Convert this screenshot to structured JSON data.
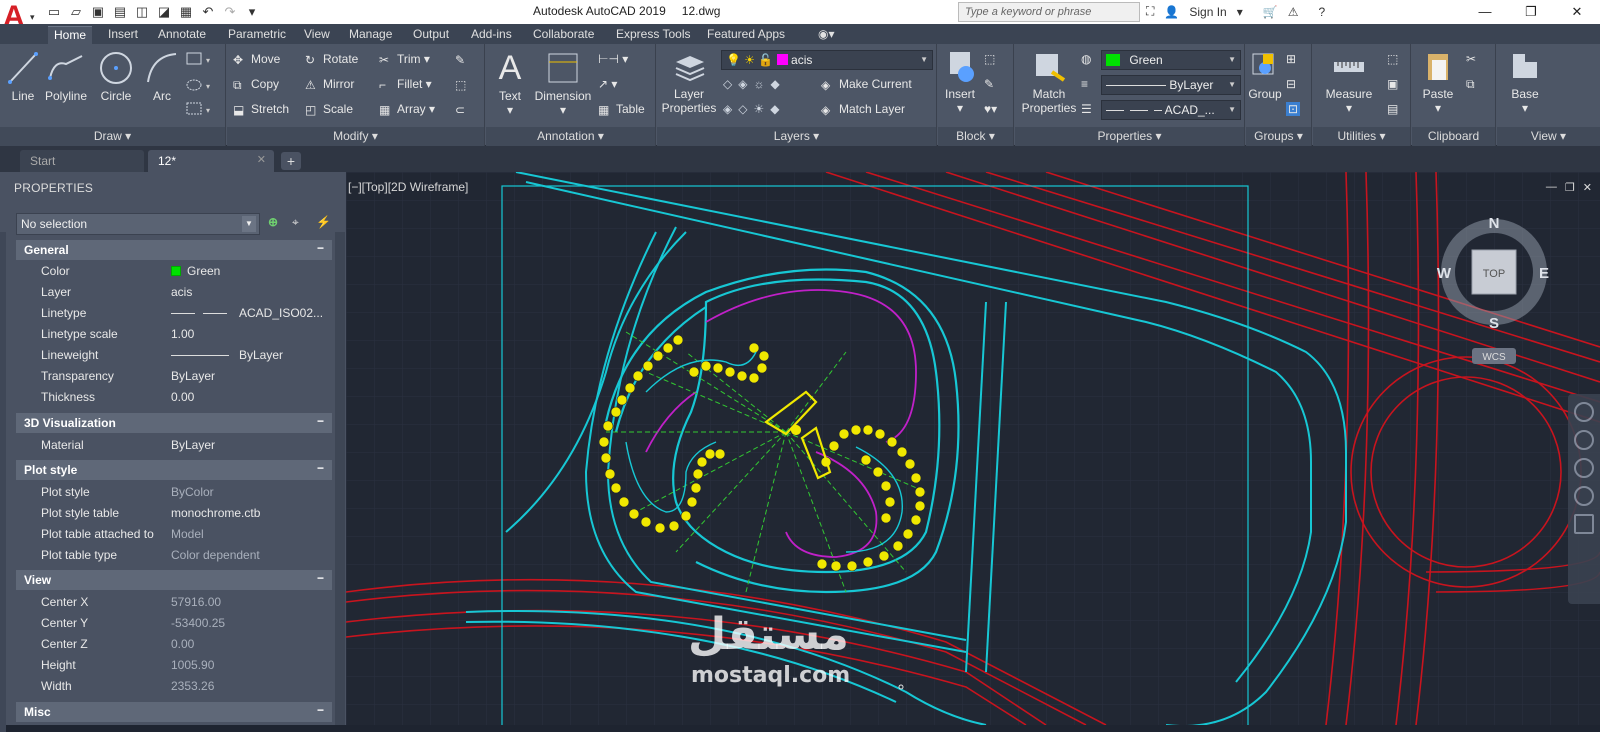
{
  "titlebar": {
    "app_name": "Autodesk AutoCAD 2019",
    "file_name": "12.dwg",
    "search_placeholder": "Type a keyword or phrase",
    "sign_in": "Sign In"
  },
  "ribbon_tabs": [
    "Home",
    "Insert",
    "Annotate",
    "Parametric",
    "View",
    "Manage",
    "Output",
    "Add-ins",
    "Collaborate",
    "Express Tools",
    "Featured Apps"
  ],
  "draw": {
    "title": "Draw",
    "line": "Line",
    "polyline": "Polyline",
    "circle": "Circle",
    "arc": "Arc"
  },
  "modify": {
    "title": "Modify",
    "move": "Move",
    "rotate": "Rotate",
    "trim": "Trim",
    "copy": "Copy",
    "mirror": "Mirror",
    "fillet": "Fillet",
    "stretch": "Stretch",
    "scale": "Scale",
    "array": "Array"
  },
  "annotation": {
    "title": "Annotation",
    "text": "Text",
    "dimension": "Dimension",
    "table": "Table"
  },
  "layers": {
    "title": "Layers",
    "layer_properties_1": "Layer",
    "layer_properties_2": "Properties",
    "current_layer": "acis",
    "make_current": "Make Current",
    "match_layer": "Match Layer"
  },
  "block": {
    "title": "Block",
    "insert": "Insert"
  },
  "properties_panel": {
    "title": "Properties",
    "match_1": "Match",
    "match_2": "Properties",
    "color": "Green",
    "lineweight": "ByLayer",
    "linetype": "ACAD_..."
  },
  "groups": {
    "title": "Groups",
    "group": "Group"
  },
  "utilities": {
    "title": "Utilities",
    "measure": "Measure"
  },
  "clipboard": {
    "title": "Clipboard",
    "paste": "Paste"
  },
  "view_panel": {
    "title": "View",
    "base": "Base"
  },
  "doc_tabs": {
    "start": "Start",
    "current": "12*"
  },
  "palette": {
    "title": "PROPERTIES",
    "selection": "No selection",
    "sections": {
      "general": "General",
      "viz3d": "3D Visualization",
      "plot": "Plot style",
      "view": "View",
      "misc": "Misc"
    },
    "general": [
      {
        "k": "Color",
        "v": "Green"
      },
      {
        "k": "Layer",
        "v": "acis"
      },
      {
        "k": "Linetype",
        "v": "ACAD_ISO02..."
      },
      {
        "k": "Linetype scale",
        "v": "1.00"
      },
      {
        "k": "Lineweight",
        "v": "ByLayer"
      },
      {
        "k": "Transparency",
        "v": "ByLayer"
      },
      {
        "k": "Thickness",
        "v": "0.00"
      }
    ],
    "viz3d": [
      {
        "k": "Material",
        "v": "ByLayer"
      }
    ],
    "plot": [
      {
        "k": "Plot style",
        "v": "ByColor"
      },
      {
        "k": "Plot style table",
        "v": "monochrome.ctb"
      },
      {
        "k": "Plot table attached to",
        "v": "Model"
      },
      {
        "k": "Plot table type",
        "v": "Color dependent"
      }
    ],
    "view": [
      {
        "k": "Center X",
        "v": "57916.00"
      },
      {
        "k": "Center Y",
        "v": "-53400.25"
      },
      {
        "k": "Center Z",
        "v": "0.00"
      },
      {
        "k": "Height",
        "v": "1005.90"
      },
      {
        "k": "Width",
        "v": "2353.26"
      }
    ]
  },
  "viewport": {
    "label": "[−][Top][2D Wireframe]",
    "compass": {
      "n": "N",
      "s": "S",
      "e": "E",
      "w": "W",
      "top": "TOP",
      "ucs": "WCS"
    }
  },
  "watermark": {
    "arabic": "مستقل",
    "latin": "mostaql.com"
  }
}
